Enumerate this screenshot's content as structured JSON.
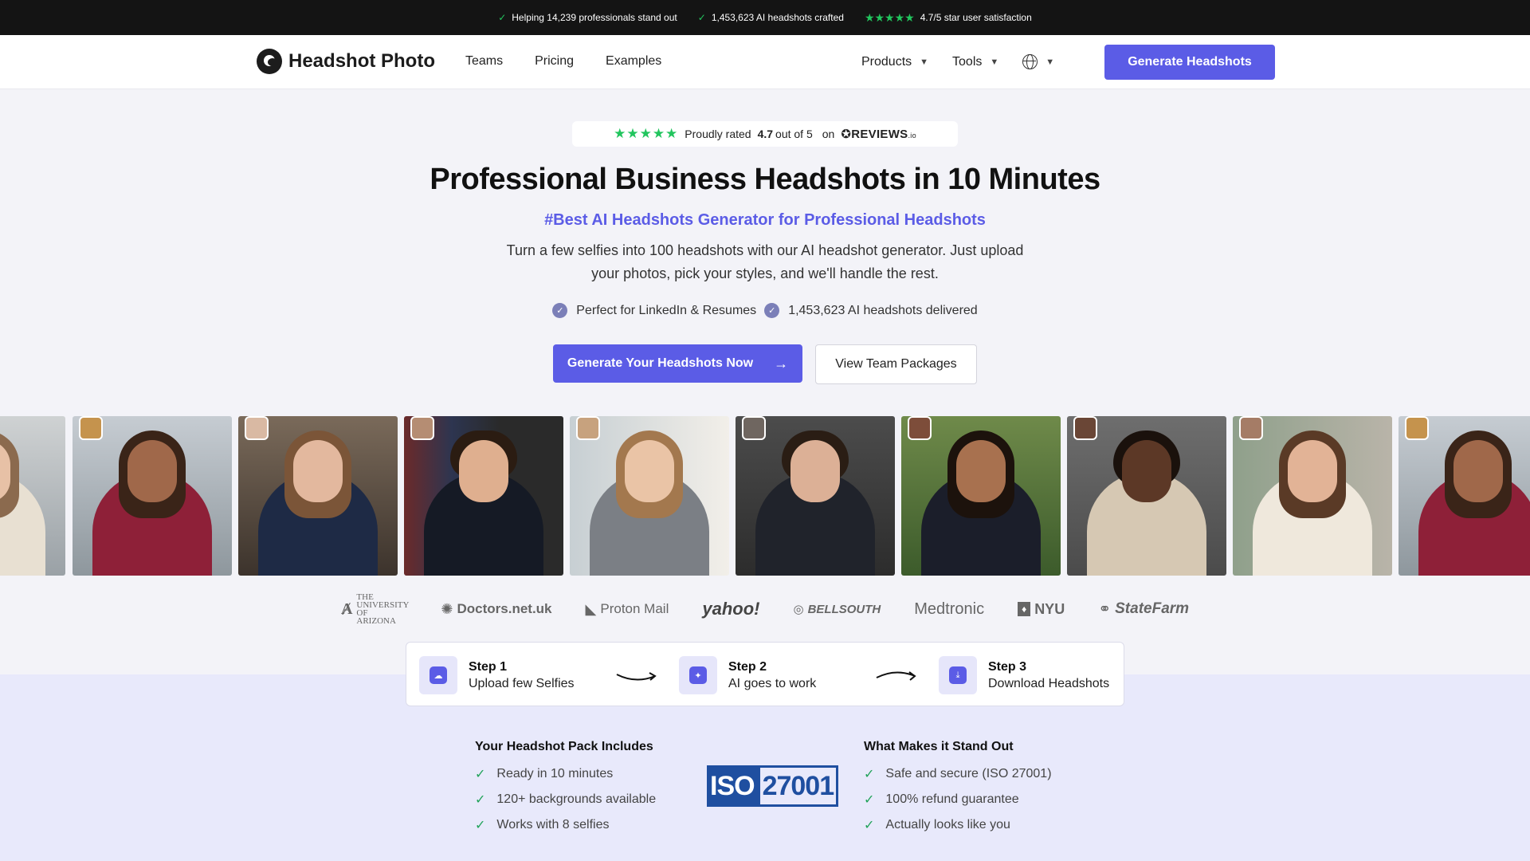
{
  "topbar": {
    "item1": "Helping 14,239 professionals stand out",
    "item2": "1,453,623 AI headshots crafted",
    "item3": "4.7/5 star user satisfaction",
    "stars": "★★★★★"
  },
  "nav": {
    "brand": "Headshot Photo",
    "links": [
      "Teams",
      "Pricing",
      "Examples"
    ],
    "products": "Products",
    "tools": "Tools",
    "cta": "Generate Headshots"
  },
  "rating": {
    "stars": "★★★★★",
    "prefix": "Proudly rated",
    "score": "4.7",
    "suffix": "out of 5",
    "on": "on",
    "brand": "REVIEWS",
    "brand_suffix": "io"
  },
  "hero": {
    "title": "Professional Business Headshots in 10 Minutes",
    "subtitle": "#Best AI Headshots Generator for Professional Headshots",
    "lead": "Turn a few selfies into 100 headshots with our AI headshot generator. Just upload your photos, pick your styles, and we'll handle the rest.",
    "badge1": "Perfect for LinkedIn & Resumes",
    "badge2": "1,453,623 AI headshots delivered",
    "primary_cta": "Generate Your Headshots Now",
    "secondary_cta": "View Team Packages"
  },
  "logos": [
    "THE UNIVERSITY OF ARIZONA",
    "Doctors.net.uk",
    "Proton Mail",
    "yahoo!",
    "BELLSOUTH",
    "Medtronic",
    "NYU",
    "StateFarm"
  ],
  "steps": [
    {
      "title": "Step 1",
      "sub": "Upload few Selfies"
    },
    {
      "title": "Step 2",
      "sub": "AI goes to work"
    },
    {
      "title": "Step 3",
      "sub": "Download Headshots"
    }
  ],
  "includes": {
    "title": "Your Headshot Pack Includes",
    "items": [
      "Ready in 10 minutes",
      "120+ backgrounds available",
      "Works with 8 selfies"
    ]
  },
  "standout": {
    "title": "What Makes it Stand Out",
    "items": [
      "Safe and secure (ISO 27001)",
      "100% refund guarantee",
      "Actually looks like you"
    ]
  },
  "iso": {
    "left": "ISO",
    "right": "27001"
  },
  "colors": {
    "accent": "#5b5ce6",
    "star": "#22c55e",
    "check": "#22a35a",
    "topbar": "#141414"
  }
}
